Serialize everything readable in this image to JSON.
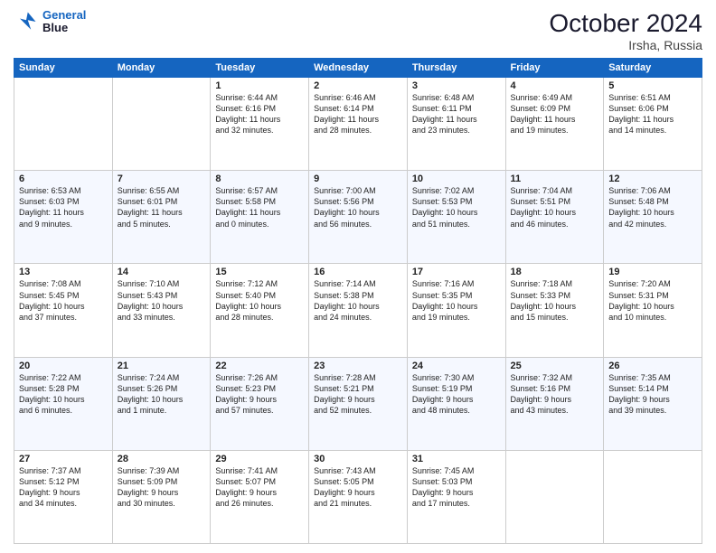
{
  "logo": {
    "line1": "General",
    "line2": "Blue"
  },
  "title": "October 2024",
  "location": "Irsha, Russia",
  "weekdays": [
    "Sunday",
    "Monday",
    "Tuesday",
    "Wednesday",
    "Thursday",
    "Friday",
    "Saturday"
  ],
  "weeks": [
    [
      {
        "day": "",
        "info": ""
      },
      {
        "day": "",
        "info": ""
      },
      {
        "day": "1",
        "info": "Sunrise: 6:44 AM\nSunset: 6:16 PM\nDaylight: 11 hours\nand 32 minutes."
      },
      {
        "day": "2",
        "info": "Sunrise: 6:46 AM\nSunset: 6:14 PM\nDaylight: 11 hours\nand 28 minutes."
      },
      {
        "day": "3",
        "info": "Sunrise: 6:48 AM\nSunset: 6:11 PM\nDaylight: 11 hours\nand 23 minutes."
      },
      {
        "day": "4",
        "info": "Sunrise: 6:49 AM\nSunset: 6:09 PM\nDaylight: 11 hours\nand 19 minutes."
      },
      {
        "day": "5",
        "info": "Sunrise: 6:51 AM\nSunset: 6:06 PM\nDaylight: 11 hours\nand 14 minutes."
      }
    ],
    [
      {
        "day": "6",
        "info": "Sunrise: 6:53 AM\nSunset: 6:03 PM\nDaylight: 11 hours\nand 9 minutes."
      },
      {
        "day": "7",
        "info": "Sunrise: 6:55 AM\nSunset: 6:01 PM\nDaylight: 11 hours\nand 5 minutes."
      },
      {
        "day": "8",
        "info": "Sunrise: 6:57 AM\nSunset: 5:58 PM\nDaylight: 11 hours\nand 0 minutes."
      },
      {
        "day": "9",
        "info": "Sunrise: 7:00 AM\nSunset: 5:56 PM\nDaylight: 10 hours\nand 56 minutes."
      },
      {
        "day": "10",
        "info": "Sunrise: 7:02 AM\nSunset: 5:53 PM\nDaylight: 10 hours\nand 51 minutes."
      },
      {
        "day": "11",
        "info": "Sunrise: 7:04 AM\nSunset: 5:51 PM\nDaylight: 10 hours\nand 46 minutes."
      },
      {
        "day": "12",
        "info": "Sunrise: 7:06 AM\nSunset: 5:48 PM\nDaylight: 10 hours\nand 42 minutes."
      }
    ],
    [
      {
        "day": "13",
        "info": "Sunrise: 7:08 AM\nSunset: 5:45 PM\nDaylight: 10 hours\nand 37 minutes."
      },
      {
        "day": "14",
        "info": "Sunrise: 7:10 AM\nSunset: 5:43 PM\nDaylight: 10 hours\nand 33 minutes."
      },
      {
        "day": "15",
        "info": "Sunrise: 7:12 AM\nSunset: 5:40 PM\nDaylight: 10 hours\nand 28 minutes."
      },
      {
        "day": "16",
        "info": "Sunrise: 7:14 AM\nSunset: 5:38 PM\nDaylight: 10 hours\nand 24 minutes."
      },
      {
        "day": "17",
        "info": "Sunrise: 7:16 AM\nSunset: 5:35 PM\nDaylight: 10 hours\nand 19 minutes."
      },
      {
        "day": "18",
        "info": "Sunrise: 7:18 AM\nSunset: 5:33 PM\nDaylight: 10 hours\nand 15 minutes."
      },
      {
        "day": "19",
        "info": "Sunrise: 7:20 AM\nSunset: 5:31 PM\nDaylight: 10 hours\nand 10 minutes."
      }
    ],
    [
      {
        "day": "20",
        "info": "Sunrise: 7:22 AM\nSunset: 5:28 PM\nDaylight: 10 hours\nand 6 minutes."
      },
      {
        "day": "21",
        "info": "Sunrise: 7:24 AM\nSunset: 5:26 PM\nDaylight: 10 hours\nand 1 minute."
      },
      {
        "day": "22",
        "info": "Sunrise: 7:26 AM\nSunset: 5:23 PM\nDaylight: 9 hours\nand 57 minutes."
      },
      {
        "day": "23",
        "info": "Sunrise: 7:28 AM\nSunset: 5:21 PM\nDaylight: 9 hours\nand 52 minutes."
      },
      {
        "day": "24",
        "info": "Sunrise: 7:30 AM\nSunset: 5:19 PM\nDaylight: 9 hours\nand 48 minutes."
      },
      {
        "day": "25",
        "info": "Sunrise: 7:32 AM\nSunset: 5:16 PM\nDaylight: 9 hours\nand 43 minutes."
      },
      {
        "day": "26",
        "info": "Sunrise: 7:35 AM\nSunset: 5:14 PM\nDaylight: 9 hours\nand 39 minutes."
      }
    ],
    [
      {
        "day": "27",
        "info": "Sunrise: 7:37 AM\nSunset: 5:12 PM\nDaylight: 9 hours\nand 34 minutes."
      },
      {
        "day": "28",
        "info": "Sunrise: 7:39 AM\nSunset: 5:09 PM\nDaylight: 9 hours\nand 30 minutes."
      },
      {
        "day": "29",
        "info": "Sunrise: 7:41 AM\nSunset: 5:07 PM\nDaylight: 9 hours\nand 26 minutes."
      },
      {
        "day": "30",
        "info": "Sunrise: 7:43 AM\nSunset: 5:05 PM\nDaylight: 9 hours\nand 21 minutes."
      },
      {
        "day": "31",
        "info": "Sunrise: 7:45 AM\nSunset: 5:03 PM\nDaylight: 9 hours\nand 17 minutes."
      },
      {
        "day": "",
        "info": ""
      },
      {
        "day": "",
        "info": ""
      }
    ]
  ]
}
